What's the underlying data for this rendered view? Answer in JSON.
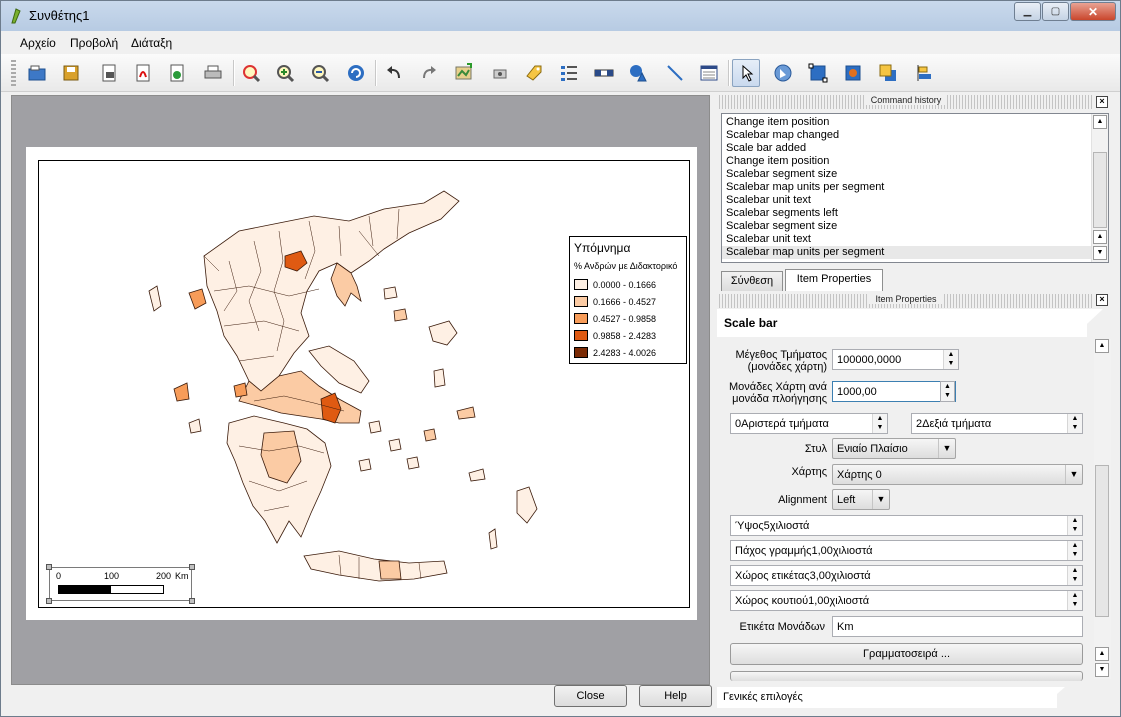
{
  "window": {
    "title": "Συνθέτης1",
    "minimize_icon": "minimize-icon",
    "maximize_icon": "maximize-icon",
    "close_icon": "close-icon"
  },
  "menu": [
    "Αρχείο",
    "Προβολή",
    "Διάταξη"
  ],
  "toolbar": {
    "buttons": [
      "open-template-icon",
      "save-template-icon",
      "export-image-icon",
      "export-pdf-icon",
      "export-svg-icon",
      "print-icon",
      "zoom-full-icon",
      "zoom-in-icon",
      "zoom-out-icon",
      "refresh-icon",
      "undo-icon",
      "redo-icon",
      "add-map-icon",
      "add-image-icon",
      "add-label-icon",
      "add-legend-icon",
      "add-scalebar-icon",
      "add-shape-icon",
      "add-arrow-icon",
      "add-table-icon",
      "select-move-icon",
      "move-content-icon",
      "group-icon",
      "ungroup-icon",
      "raise-icon",
      "align-icon"
    ]
  },
  "legend": {
    "title": "Υπόμνημα",
    "subtitle": "% Ανδρών με Διδακτορικό",
    "classes": [
      {
        "label": "0.0000 - 0.1666",
        "color": "#fef0e4"
      },
      {
        "label": "0.1666 - 0.4527",
        "color": "#fbcba4"
      },
      {
        "label": "0.4527 - 0.9858",
        "color": "#f79c59"
      },
      {
        "label": "0.9858 - 2.4283",
        "color": "#df5a12"
      },
      {
        "label": "2.4283 - 4.0026",
        "color": "#7a2a04"
      }
    ]
  },
  "scalebar": {
    "ticks": [
      "0",
      "100",
      "200"
    ],
    "unit": "Km"
  },
  "command_history": {
    "title": "Command history",
    "items": [
      "Change item position",
      "Scalebar map changed",
      "Scale bar added",
      "Change item position",
      "Scalebar segment size",
      "Scalebar map units per segment",
      "Scalebar unit text",
      "Scalebar segments left",
      "Scalebar segment size",
      "Scalebar unit text",
      "Scalebar map units per segment"
    ],
    "selected_index": 10
  },
  "tabs": [
    "Σύνθεση",
    "Item Properties"
  ],
  "active_tab": 1,
  "item_properties": {
    "title": "Item Properties",
    "section": "Scale bar",
    "segment_size_label": "Μέγεθος Τμήματος (μονάδες χάρτη)",
    "segment_size_value": "100000,0000",
    "map_units_label": "Μονάδες Χάρτη ανά μονάδα πλοήγησης",
    "map_units_value": "1000,00",
    "segments_left": "0Αριστερά τμήματα",
    "segments_right": "2Δεξιά τμήματα",
    "style_label": "Στυλ",
    "style_value": "Ενιαίο Πλαίσιο",
    "map_label": "Χάρτης",
    "map_value": "Χάρτης 0",
    "alignment_label": "Alignment",
    "alignment_value": "Left",
    "height_value": "Ύψος5χιλιοστά",
    "line_width_value": "Πάχος γραμμής1,00χιλιοστά",
    "label_space_value": "Χώρος ετικέτας3,00χιλιοστά",
    "box_space_value": "Χώρος κουτιού1,00χιλιοστά",
    "unit_label_label": "Ετικέτα Μονάδων",
    "unit_label_value": "Km",
    "font_button": "Γραμματοσειρά ...",
    "general_options": "Γενικές επιλογές"
  },
  "buttons": {
    "close": "Close",
    "help": "Help"
  }
}
